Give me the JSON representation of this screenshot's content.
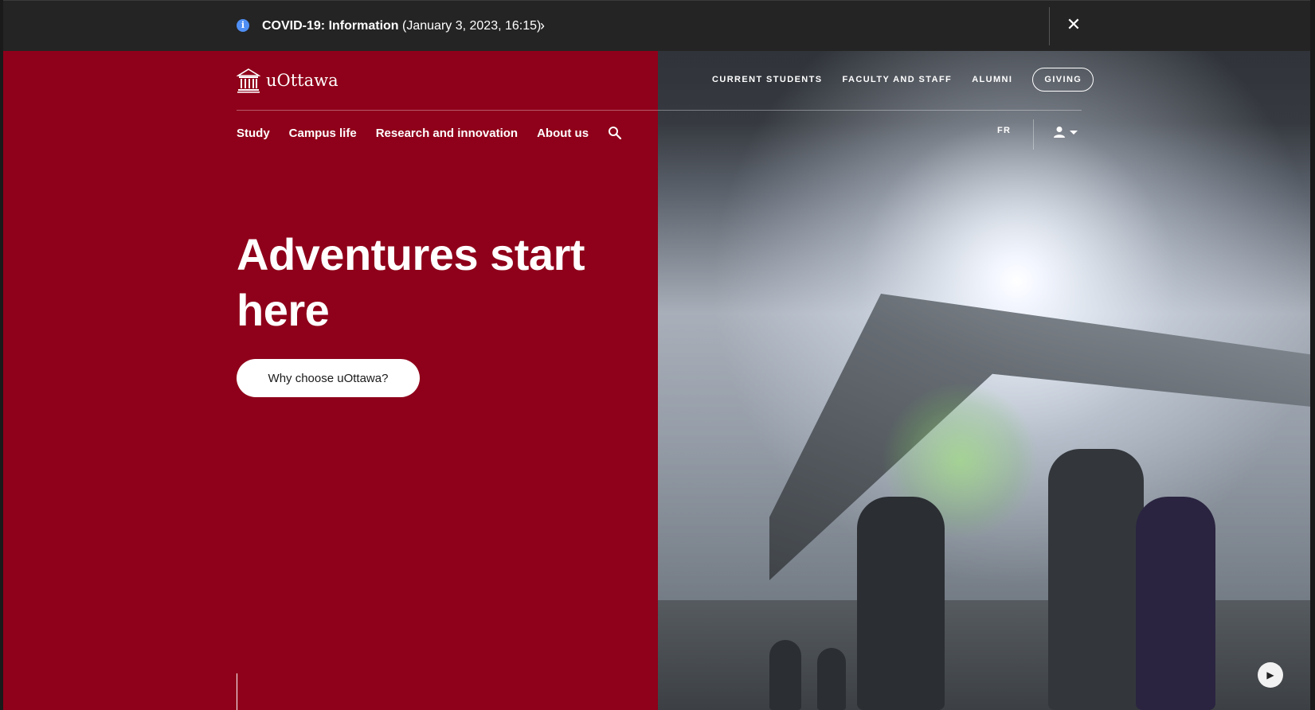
{
  "alert": {
    "label": "COVID-19: Information",
    "date": "(January 3, 2023, 16:15)",
    "chevron": "›",
    "close": "✕",
    "info_icon": "i"
  },
  "header": {
    "logo_text": "uOttawa",
    "top_nav": [
      "CURRENT STUDENTS",
      "FACULTY AND STAFF",
      "ALUMNI",
      "GIVING"
    ],
    "main_nav": [
      "Study",
      "Campus life",
      "Research and innovation",
      "About us"
    ],
    "language": "FR"
  },
  "hero": {
    "title": "Adventures start here",
    "cta": "Why choose uOttawa?",
    "play_icon": "▶"
  },
  "colors": {
    "brand": "#8f001a",
    "alert_bg": "#242424",
    "info_blue": "#4f8ff5"
  },
  "icons": [
    "info-icon",
    "chevron-right-icon",
    "close-icon",
    "university-logo-icon",
    "search-icon",
    "user-icon",
    "caret-down-icon",
    "play-icon"
  ]
}
